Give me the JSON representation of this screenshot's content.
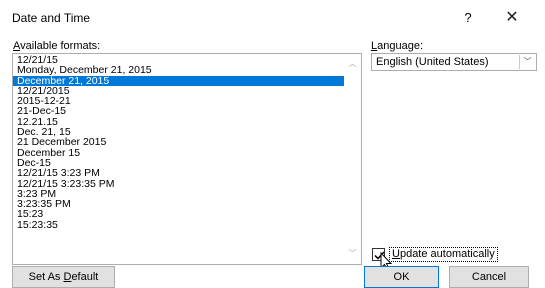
{
  "window": {
    "title": "Date and Time",
    "help_symbol": "?",
    "close_symbol": "✕"
  },
  "formats": {
    "label_access_key": "A",
    "label_rest": "vailable formats:",
    "items": [
      "12/21/15",
      "Monday, December 21, 2015",
      "December 21, 2015",
      "12/21/2015",
      "2015-12-21",
      "21-Dec-15",
      "12.21.15",
      "Dec. 21, 15",
      "21 December 2015",
      "December 15",
      "Dec-15",
      "12/21/15 3:23 PM",
      "12/21/15 3:23:35 PM",
      "3:23 PM",
      "3:23:35 PM",
      "15:23",
      "15:23:35"
    ],
    "selected": "December 21, 2015"
  },
  "language": {
    "label_access_key": "L",
    "label_rest": "anguage:",
    "value": "English (United States)"
  },
  "update": {
    "checked": true,
    "label_access_key": "U",
    "label_rest": "pdate automatically"
  },
  "buttons": {
    "default_pre": "Set As ",
    "default_key": "D",
    "default_post": "efault",
    "ok": "OK",
    "cancel": "Cancel"
  }
}
